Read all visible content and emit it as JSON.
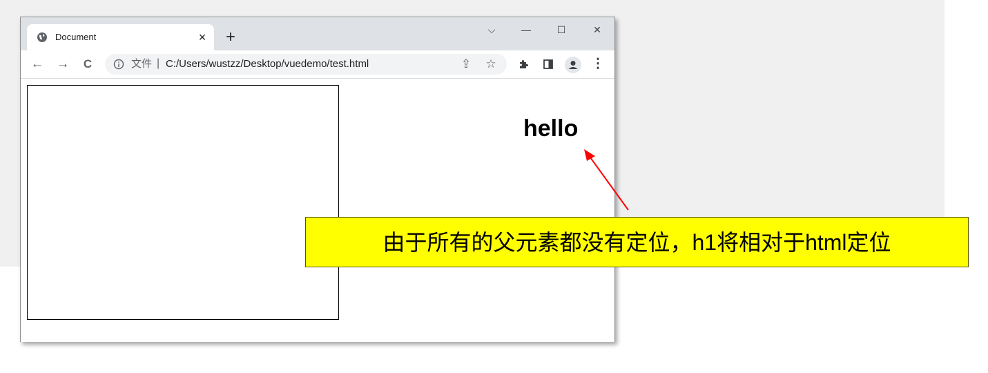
{
  "browser": {
    "tab": {
      "title": "Document",
      "close_glyph": "×"
    },
    "new_tab_glyph": "+",
    "window_controls": {
      "dropdown": "⌵",
      "minimize": "—",
      "maximize": "☐",
      "close": "✕"
    },
    "nav": {
      "back": "←",
      "forward": "→",
      "reload": "C"
    },
    "omnibox": {
      "scheme_label": "文件",
      "separator": "|",
      "url": "C:/Users/wustzz/Desktop/vuedemo/test.html",
      "share_glyph": "⇪",
      "bookmark_glyph": "☆"
    },
    "toolbar_icons": {
      "extensions": "puzzle-icon",
      "sidepanel": "sidepanel-icon",
      "profile": "profile-icon",
      "menu": "⋮"
    }
  },
  "page": {
    "heading": "hello"
  },
  "annotation": {
    "text": "由于所有的父元素都没有定位，h1将相对于html定位",
    "arrow_color": "#ff0000",
    "background": "#ffff00"
  }
}
